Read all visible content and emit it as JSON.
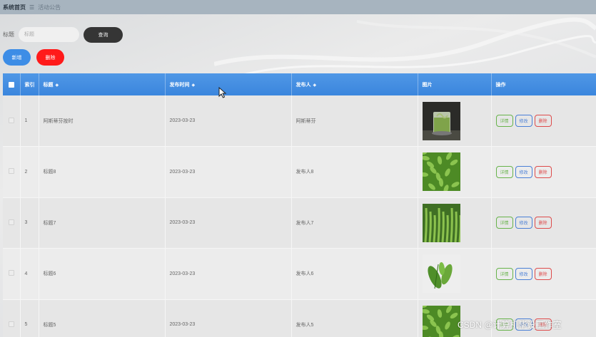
{
  "breadcrumb": {
    "home": "系统首页",
    "separator": "☰",
    "current": "活动公告"
  },
  "search": {
    "label": "标题",
    "placeholder": "标题",
    "button": "查询"
  },
  "actions": {
    "add": "新增",
    "delete": "删除"
  },
  "colors": {
    "topbar": "#a7b4bf",
    "header": "#3d86dd",
    "add_button": "#3d8de6",
    "delete_button": "#ff1a1a",
    "query_button": "#353535"
  },
  "table": {
    "headers": {
      "index": "索引",
      "title": "标题",
      "publish_time": "发布时间",
      "publisher": "发布人",
      "image": "图片",
      "ops": "操作"
    },
    "sort_icon": "sort-icon",
    "rows": [
      {
        "index": "1",
        "title": "阿斯蒂芬按时",
        "time": "2023-03-23",
        "publisher": "阿斯蒂芬",
        "image": "tea-cup-image",
        "detail": "详情",
        "edit": "修改",
        "del": "删除"
      },
      {
        "index": "2",
        "title": "标题8",
        "time": "2023-03-23",
        "publisher": "发布人8",
        "image": "tea-field-image",
        "detail": "详情",
        "edit": "修改",
        "del": "删除"
      },
      {
        "index": "3",
        "title": "标题7",
        "time": "2023-03-23",
        "publisher": "发布人7",
        "image": "tea-bud-image",
        "detail": "详情",
        "edit": "修改",
        "del": "删除"
      },
      {
        "index": "4",
        "title": "标题6",
        "time": "2023-03-23",
        "publisher": "发布人6",
        "image": "tea-leaves-image",
        "detail": "详情",
        "edit": "修改",
        "del": "删除"
      },
      {
        "index": "5",
        "title": "标题5",
        "time": "2023-03-23",
        "publisher": "发布人5",
        "image": "tea-field-image",
        "detail": "详情",
        "edit": "修改",
        "del": "删除"
      }
    ]
  },
  "watermark": "CSDN @计算机毕设工作室"
}
